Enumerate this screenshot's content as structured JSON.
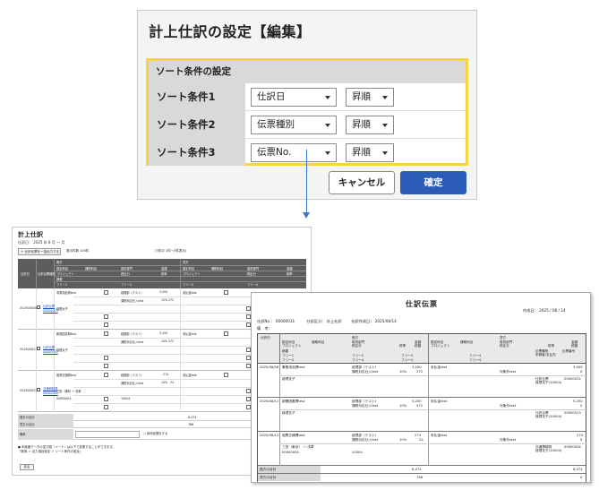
{
  "dialog": {
    "title": "計上仕訳の設定【編集】",
    "panel_title": "ソート条件の設定",
    "rows": [
      {
        "label": "ソート条件1",
        "field": "仕訳日",
        "order": "昇順"
      },
      {
        "label": "ソート条件2",
        "field": "伝票種別",
        "order": "昇順"
      },
      {
        "label": "ソート条件3",
        "field": "伝票No.",
        "order": "昇順"
      }
    ],
    "cancel_label": "キャンセル",
    "confirm_label": "確定"
  },
  "list_screen": {
    "title": "計上仕訳",
    "filter": "仕訳日： 2025 年 8 月 ～ 月",
    "toolbar_button": "＋ 仕訳伝票を一括出力する",
    "toolbar_text": "表示件数 100件　　　　　　　　　　　　　　　　　　　　　［3件中 1件～3件表示］",
    "header": {
      "col_date": "仕訳日",
      "col_slip": "仕訳伝票種別",
      "debit": "借方",
      "credit": "貸方",
      "account": "勘定科目",
      "sub_account": "補助科目",
      "dept": "負担部門",
      "amount": "金額",
      "project": "プロジェクト",
      "tax": "税区分",
      "tax_rate": "税率",
      "summary": "摘要",
      "free1": "フリー1",
      "free2": "フリー2",
      "free3": "フリー3",
      "free4": "フリー4"
    },
    "rows": [
      {
        "date": "2025/08/06",
        "slip_type": "仕訳伝票",
        "slip_no": "00000013",
        "debit_account": "事業用品費test",
        "debit_dept": "経理部（テスト）",
        "debit_amount": "3,000",
        "credit_account": "未払金test",
        "memo": "経理太子",
        "tax": "課税対応仕入test",
        "rate": "10%",
        "tax_amount": "272"
      },
      {
        "date": "2025/08/11",
        "slip_type": "仕訳伝票",
        "slip_no": "00000014",
        "debit_account": "新聞図書費test",
        "debit_dept": "経理部（テスト）",
        "debit_amount": "5,200",
        "credit_account": "未払金test",
        "memo": "経理太子",
        "tax": "課税対応仕入test",
        "rate": "10%",
        "tax_amount": "472"
      },
      {
        "date": "2025/08/12",
        "slip_type": "交通費精算",
        "slip_no": "00000004",
        "debit_account": "旅費交通費test",
        "debit_dept": "経理部（テスト）",
        "debit_amount": "274",
        "credit_account": "未払金test",
        "memo": "三田・勝利 ～ 浅草",
        "tax": "課税対応仕入test",
        "rate": "10%",
        "tax_amount": "24",
        "extra": "00000004",
        "extra2": "10004"
      }
    ],
    "debit_total_label": "借方の合計",
    "credit_total_label": "貸方の合計",
    "debit_total": "8,474",
    "credit_total": "768",
    "memo_label": "備考",
    "memo_check": "□ 締め処理をする",
    "footer_note": "● 本画面データの並び順（ソート）は以下で変更することができます。",
    "footer_note2": "「帳簿 ＞ 出力項目設定 ＞ ソート条件の設定」",
    "back_label": "戻る"
  },
  "document": {
    "title": "仕訳伝票",
    "created_label": "作成日：",
    "created_date": "2025 / 08 / 14",
    "slip_no_label": "仕訳No.：",
    "slip_no": "00000031",
    "slip_type_label": "仕訳区分：",
    "slip_type": "計上仕訳",
    "entry_date_label": "仕訳作成日：",
    "entry_date": "2025/08/14",
    "note_label": "備　考：",
    "header": {
      "date": "仕訳日",
      "debit": "借方",
      "credit": "貸方",
      "account": "勘定科目",
      "sub_account": "補助科目",
      "dept": "負担部門",
      "amount": "金額",
      "project": "プロジェクト",
      "tax": "税区分",
      "rate": "税率",
      "tax_amount": "税額",
      "summary": "摘要",
      "free1": "フリー1",
      "free2": "フリー2",
      "free3": "フリー3",
      "free4": "フリー4",
      "applicant": "伝票種別",
      "slip_no": "伝票番号",
      "payee": "申請者/支払先"
    },
    "rows": [
      {
        "date": "2025/08/06",
        "account": "事業用品費test",
        "dept": "経理部（テスト）",
        "amount": "3,000",
        "credit_account": "未払金test",
        "credit_amount": "3,000",
        "tax": "課税対応仕入test",
        "rate": "10%",
        "tax_amount": "272",
        "summary": "経理花子",
        "cred_sub": "対象外test",
        "cred_val": "0",
        "slip_kind": "仕訳伝票",
        "slip_no": "00000014",
        "payee": "経理花子(10004)"
      },
      {
        "date": "2025/08/11",
        "account": "新聞図書費test",
        "dept": "経理部（テスト）",
        "amount": "5,200",
        "credit_account": "未払金test",
        "credit_amount": "5,200",
        "tax": "課税対応仕入test",
        "rate": "10%",
        "tax_amount": "472",
        "summary": "経理花子",
        "cred_sub": "対象外test",
        "cred_val": "0",
        "slip_kind": "仕訳伝票",
        "slip_no": "00000013",
        "payee": "経理花子(10004)"
      },
      {
        "date": "2025/08/12",
        "account": "旅費交通費test",
        "dept": "経理部（テスト）",
        "amount": "274",
        "credit_account": "未払金test",
        "credit_amount": "274",
        "tax": "課税対応仕入test",
        "rate": "10%",
        "tax_amount": "24",
        "summary": "三田（東京） ～ 浅草",
        "cred_sub": "対象外test",
        "cred_val": "0",
        "slip_kind": "交通費精算",
        "slip_no": "00000004",
        "payee": "経理花子(10004)",
        "extra": "00000004",
        "extra2": "10004"
      }
    ],
    "debit_total_label": "借方の合計",
    "credit_total_label": "貸方の合計",
    "debit_total": "8,474",
    "debit_tax": "768",
    "credit_total": "8,474",
    "credit_tax": "0"
  },
  "colors": {
    "confirm_button": "#2b5cb8",
    "panel_highlight": "#f5d53f",
    "connector": "#3a78c9",
    "header_dark": "#5d5d5d"
  }
}
